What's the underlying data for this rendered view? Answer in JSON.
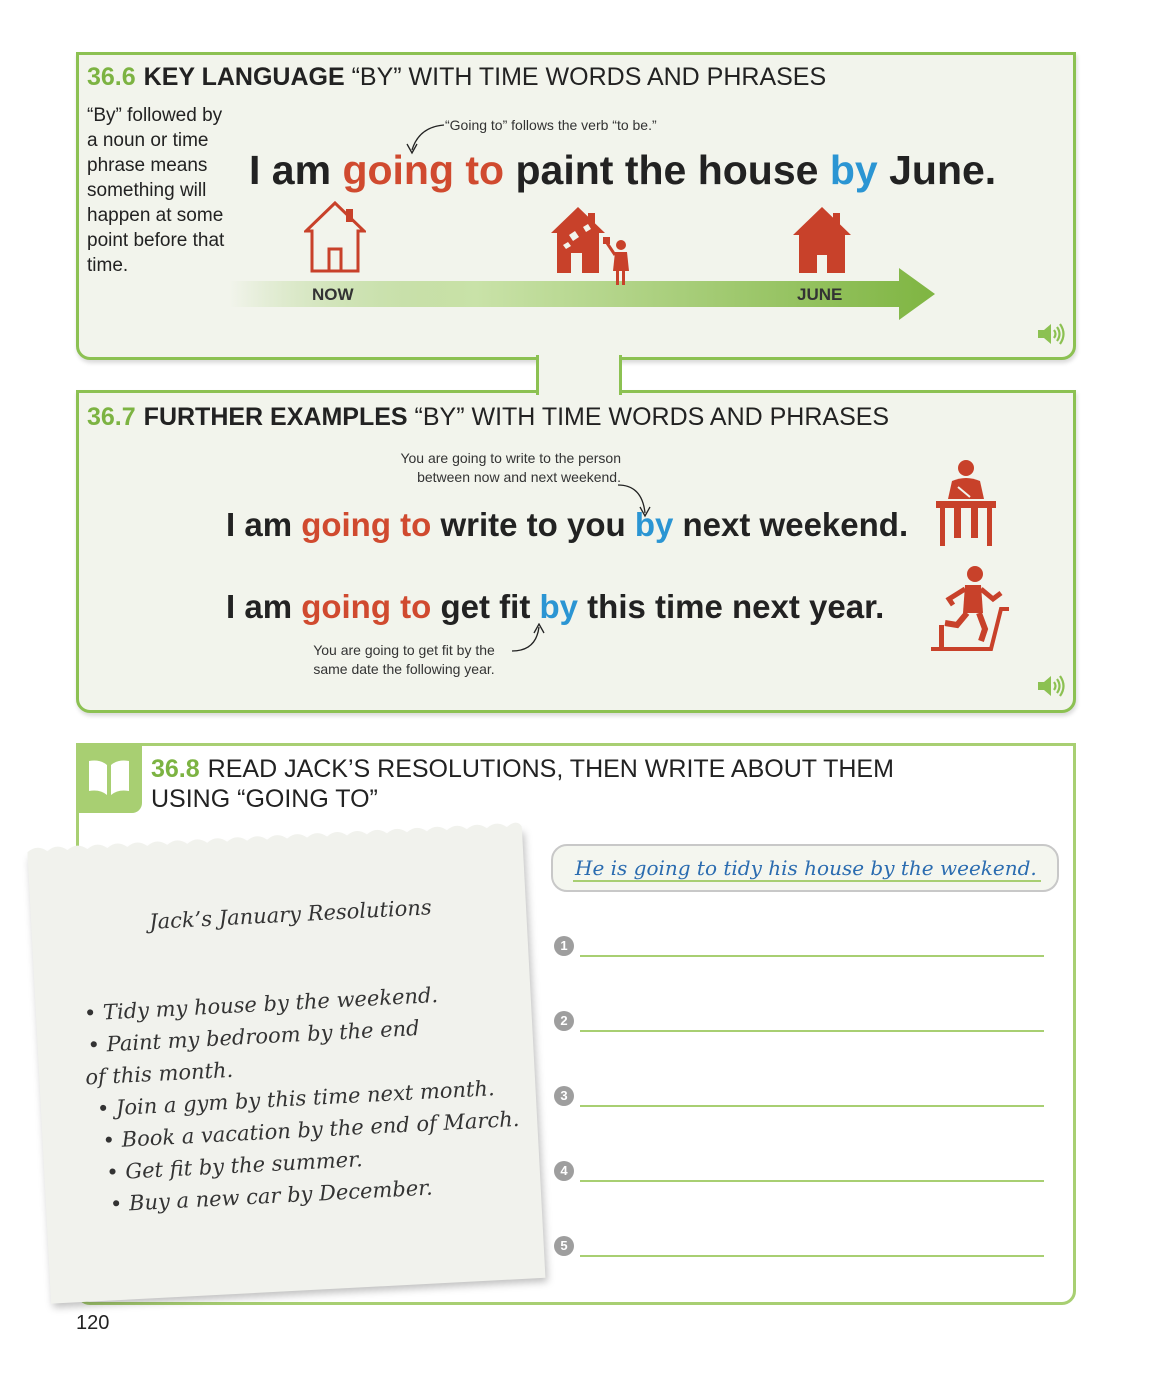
{
  "s366": {
    "num": "36.6",
    "title_bold": "KEY LANGUAGE",
    "title_rest": "“BY” WITH TIME WORDS AND PHRASES",
    "side_text": "“By” followed by a noun or time phrase means something will happen at some point before that time.",
    "note": "“Going to” follows the verb “to be.”",
    "sentence": {
      "p1": "I am ",
      "p2": "going to",
      "p3": " paint the house ",
      "p4": "by",
      "p5": " June."
    },
    "timeline": {
      "now": "NOW",
      "june": "JUNE"
    }
  },
  "s367": {
    "num": "36.7",
    "title_bold": "FURTHER EXAMPLES",
    "title_rest": "“BY” WITH TIME WORDS AND PHRASES",
    "note1_line1": "You are going to write to the person",
    "note1_line2": "between now and next weekend.",
    "sentence1": {
      "p1": "I am ",
      "p2": "going to",
      "p3": " write to you ",
      "p4": "by",
      "p5": " next weekend."
    },
    "sentence2": {
      "p1": "I am ",
      "p2": "going to",
      "p3": " get fit ",
      "p4": "by",
      "p5": " this time next year."
    },
    "note2_line1": "You are going to get fit by the",
    "note2_line2": "same date the following year."
  },
  "s368": {
    "num": "36.8",
    "title_line1": "READ JACK’S RESOLUTIONS, THEN WRITE ABOUT THEM",
    "title_line2": "USING “GOING TO”",
    "note_title": "Jack’s January Resolutions",
    "note_items": [
      "• Tidy my house by the weekend.",
      "• Paint my bedroom by the end",
      "of this month.",
      "• Join a gym by this time next month.",
      "• Book a vacation by the end of March.",
      "• Get fit by the summer.",
      "• Buy a new car by December."
    ],
    "example_answer": "He is going to tidy his house by the weekend.",
    "answer_numbers": [
      "1",
      "2",
      "3",
      "4",
      "5"
    ]
  },
  "page_number": "120",
  "icons": [
    "house-outline-icon",
    "house-painting-icon",
    "house-filled-icon",
    "person-writing-icon",
    "person-treadmill-icon",
    "speaker-icon",
    "book-icon"
  ],
  "colors": {
    "accent_green": "#8cc152",
    "going_to_red": "#d04a2f",
    "by_blue": "#2b95d3",
    "icon_red": "#c8412a"
  }
}
